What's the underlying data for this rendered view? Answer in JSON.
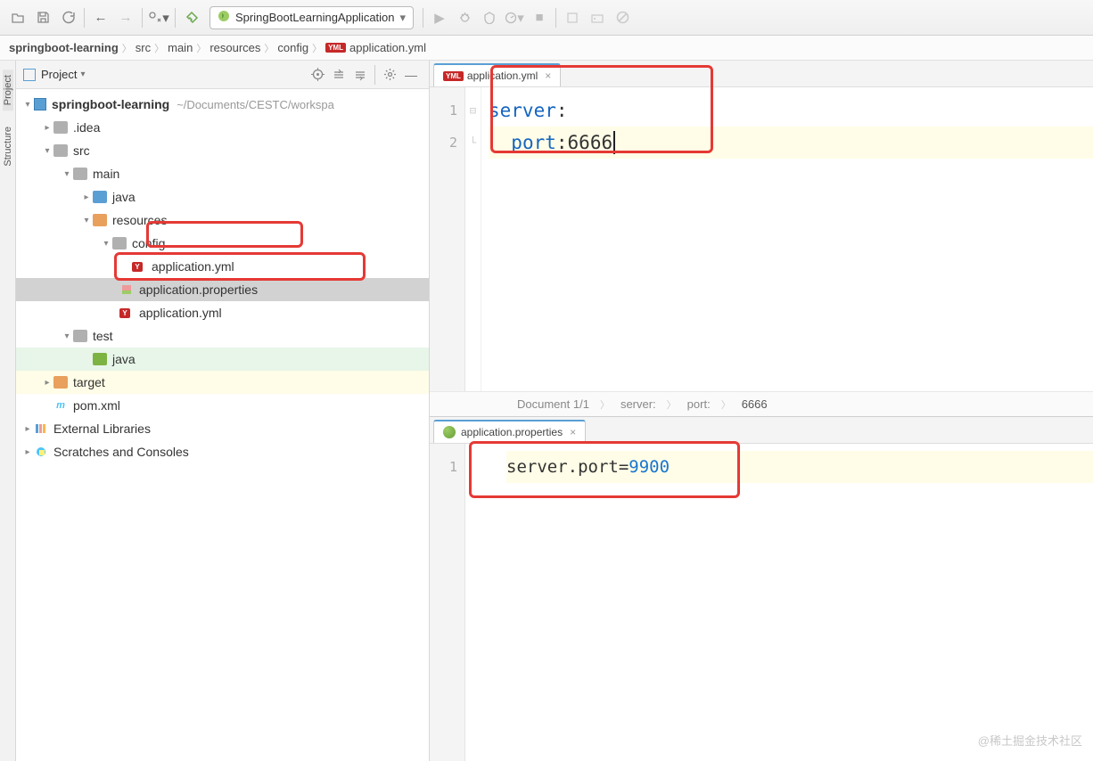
{
  "toolbar": {
    "run_config": "SpringBootLearningApplication"
  },
  "breadcrumb": {
    "project": "springboot-learning",
    "parts": [
      "src",
      "main",
      "resources",
      "config"
    ],
    "file": "application.yml"
  },
  "sidebar": {
    "project_tab": "Project",
    "structure_tab": "Structure"
  },
  "project_pane": {
    "title": "Project",
    "root": {
      "name": "springboot-learning",
      "path": "~/Documents/CESTC/workspa"
    },
    "nodes": {
      "idea": ".idea",
      "src": "src",
      "main": "main",
      "java1": "java",
      "resources": "resources",
      "config": "config",
      "app_yml1": "application.yml",
      "app_props": "application.properties",
      "app_yml2": "application.yml",
      "test": "test",
      "java2": "java",
      "target": "target",
      "pom": "pom.xml",
      "ext_libs": "External Libraries",
      "scratches": "Scratches and Consoles"
    }
  },
  "editor_top": {
    "tab": "application.yml",
    "lines": {
      "l1_key": "server",
      "l1_colon": ":",
      "l2_key": "port",
      "l2_colon": ": ",
      "l2_val": "6666"
    },
    "crumb": {
      "doc": "Document 1/1",
      "k1": "server:",
      "k2": "port:",
      "val": "6666"
    }
  },
  "editor_bottom": {
    "tab": "application.properties",
    "lines": {
      "l1_key": "server.port",
      "l1_eq": "=",
      "l1_val": "9900"
    }
  },
  "gutter": {
    "n1": "1",
    "n2": "2"
  },
  "watermark": "@稀土掘金技术社区"
}
